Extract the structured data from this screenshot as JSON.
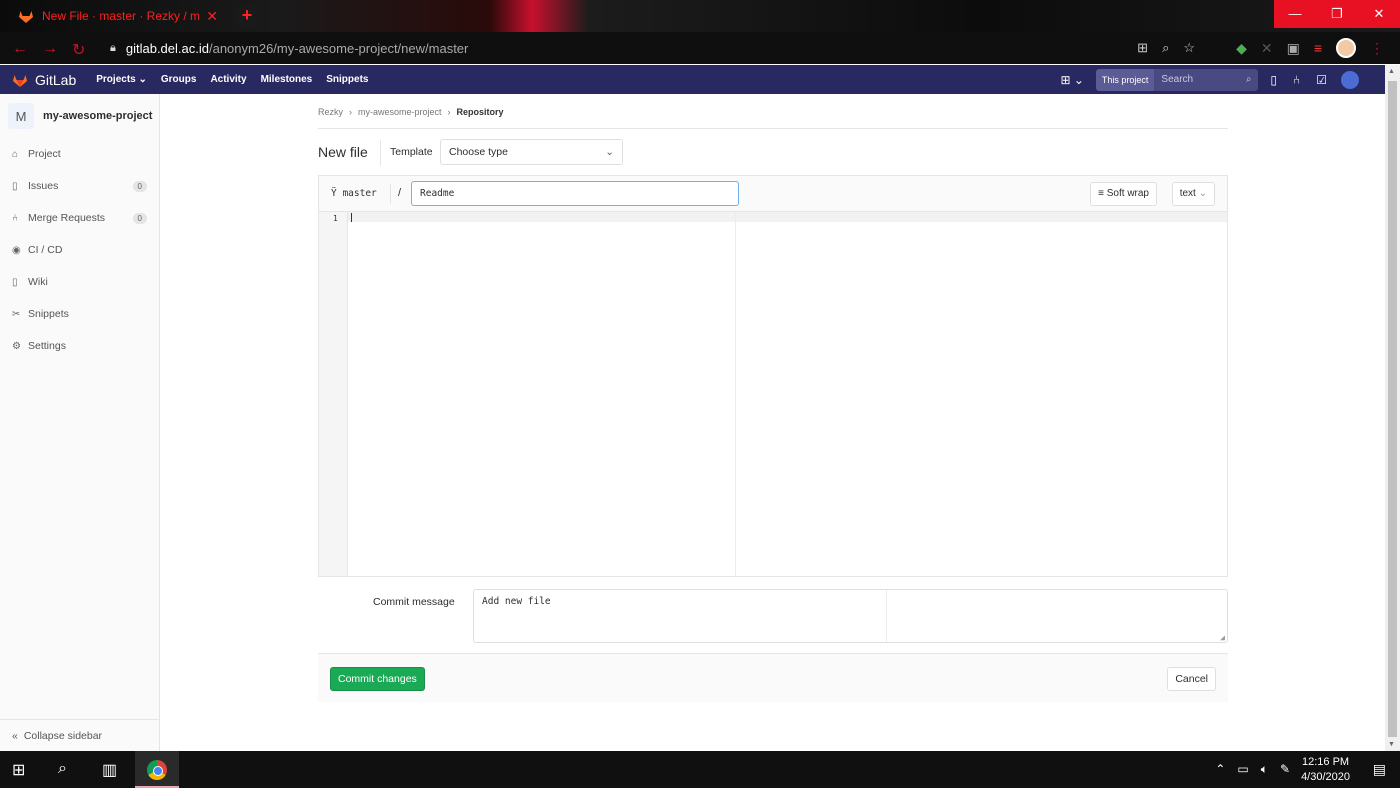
{
  "browser": {
    "tab_title": "New File · master · Rezky / my-aw",
    "url_host": "gitlab.del.ac.id",
    "url_path": "/anonym26/my-awesome-project/new/master",
    "window_buttons": [
      "—",
      "❐",
      "✕"
    ]
  },
  "header": {
    "brand": "GitLab",
    "nav": [
      "Projects ⌄",
      "Groups",
      "Activity",
      "Milestones",
      "Snippets"
    ],
    "search_scope": "This project",
    "search_placeholder": "Search"
  },
  "sidebar": {
    "project_initial": "M",
    "project_name": "my-awesome-project",
    "items": [
      {
        "label": "Project",
        "icon": "home-icon",
        "glyph": "⌂",
        "count": ""
      },
      {
        "label": "Issues",
        "icon": "issues-icon",
        "glyph": "▯",
        "count": "0"
      },
      {
        "label": "Merge Requests",
        "icon": "merge-request-icon",
        "glyph": "⑃",
        "count": "0"
      },
      {
        "label": "CI / CD",
        "icon": "rocket-icon",
        "glyph": "◉",
        "count": ""
      },
      {
        "label": "Wiki",
        "icon": "book-icon",
        "glyph": "▯",
        "count": ""
      },
      {
        "label": "Snippets",
        "icon": "scissors-icon",
        "glyph": "✂",
        "count": ""
      },
      {
        "label": "Settings",
        "icon": "gear-icon",
        "glyph": "⚙",
        "count": ""
      }
    ],
    "collapse_label": "Collapse sidebar"
  },
  "breadcrumb": [
    "Rezky",
    "my-awesome-project",
    "Repository"
  ],
  "page": {
    "title": "New file",
    "template_label": "Template",
    "template_value": "Choose type"
  },
  "editor": {
    "branch": "master",
    "separator": "/",
    "file_name": "Readme",
    "soft_wrap_label": "Soft wrap",
    "mode_value": "text",
    "line_number": "1"
  },
  "commit": {
    "label": "Commit message",
    "message": "Add new file",
    "commit_button": "Commit changes",
    "cancel_button": "Cancel"
  },
  "taskbar": {
    "time": "12:16 PM",
    "date": "4/30/2020"
  },
  "colors": {
    "header_bg": "#292961",
    "commit_green": "#1aaa55",
    "browser_accent": "#ff2020"
  }
}
